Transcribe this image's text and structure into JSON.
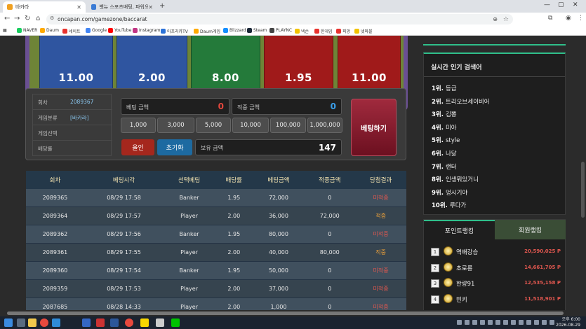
{
  "browser": {
    "tabs": [
      {
        "title": "바카라",
        "active": true
      },
      {
        "title": "벳뉴 스포츠배팅, 파워오락카지...",
        "active": false
      }
    ],
    "url": "oncapan.com/gamezone/baccarat",
    "bookmarks": [
      "NAVER",
      "Daum",
      "네이트",
      "Google",
      "YouTube",
      "Instagram",
      "아프리카TV",
      "Daum게임",
      "Blizzard",
      "Steam",
      "PLAYNC",
      "넥슨",
      "한게임",
      "피망",
      "넷마블"
    ]
  },
  "odds": [
    {
      "value": "11.00",
      "color": "#2f55a0"
    },
    {
      "value": "2.00",
      "color": "#2f55a0"
    },
    {
      "value": "8.00",
      "color": "#247a3a"
    },
    {
      "value": "1.95",
      "color": "#a01a1a"
    },
    {
      "value": "11.00",
      "color": "#a01a1a"
    }
  ],
  "info": {
    "round_label": "회차",
    "round_value": "2089367",
    "category_label": "게임분류",
    "category_value": "[바카라]",
    "selection_label": "게임선택",
    "selection_value": "",
    "rate_label": "배당률",
    "rate_value": ""
  },
  "bet": {
    "amount_label": "베팅 금액",
    "amount_value": "0",
    "win_label": "적중 금액",
    "win_value": "0",
    "chips": [
      "1,000",
      "3,000",
      "5,000",
      "10,000",
      "100,000",
      "1,000,000"
    ],
    "allin_label": "올인",
    "reset_label": "초기화",
    "balance_label": "보유 금액",
    "balance_value": "147",
    "submit_label": "베팅하기"
  },
  "history": {
    "headers": [
      "회차",
      "베팅시각",
      "선택베팅",
      "배당률",
      "베팅금액",
      "적중금액",
      "당첨결과"
    ],
    "rows": [
      [
        "2089365",
        "08/29 17:58",
        "Banker",
        "1.95",
        "72,000",
        "0",
        "미적중"
      ],
      [
        "2089364",
        "08/29 17:57",
        "Player",
        "2.00",
        "36,000",
        "72,000",
        "적중"
      ],
      [
        "2089362",
        "08/29 17:56",
        "Banker",
        "1.95",
        "80,000",
        "0",
        "미적중"
      ],
      [
        "2089361",
        "08/29 17:55",
        "Player",
        "2.00",
        "40,000",
        "80,000",
        "적중"
      ],
      [
        "2089360",
        "08/29 17:54",
        "Banker",
        "1.95",
        "50,000",
        "0",
        "미적중"
      ],
      [
        "2089359",
        "08/29 17:53",
        "Player",
        "2.00",
        "37,000",
        "0",
        "미적중"
      ],
      [
        "2087685",
        "08/28 14:33",
        "Player",
        "2.00",
        "1,000",
        "0",
        "미적중"
      ]
    ]
  },
  "popular": {
    "title": "실시간 인기 검색어",
    "items": [
      {
        "rank": "1위.",
        "term": "등급"
      },
      {
        "rank": "2위.",
        "term": "트리오브세이비어"
      },
      {
        "rank": "3위.",
        "term": "김뽕"
      },
      {
        "rank": "4위.",
        "term": "미아"
      },
      {
        "rank": "5위.",
        "term": "style"
      },
      {
        "rank": "6위.",
        "term": "나닮"
      },
      {
        "rank": "7위.",
        "term": "랜터"
      },
      {
        "rank": "8위.",
        "term": "인생뭐있거니"
      },
      {
        "rank": "9위.",
        "term": "멍시기야"
      },
      {
        "rank": "10위.",
        "term": "루다가"
      }
    ]
  },
  "ranking": {
    "tab_point": "포인트랭킹",
    "tab_member": "회원랭킹",
    "rows": [
      {
        "no": "1",
        "name": "역배강승",
        "points": "20,590,025 P"
      },
      {
        "no": "2",
        "name": "초로롱",
        "points": "14,661,705 P"
      },
      {
        "no": "3",
        "name": "한량91",
        "points": "12,535,158 P"
      },
      {
        "no": "4",
        "name": "빈키",
        "points": "11,518,901 P"
      }
    ]
  },
  "clock": {
    "time": "오후 6:00",
    "date": "2026-08-29"
  }
}
